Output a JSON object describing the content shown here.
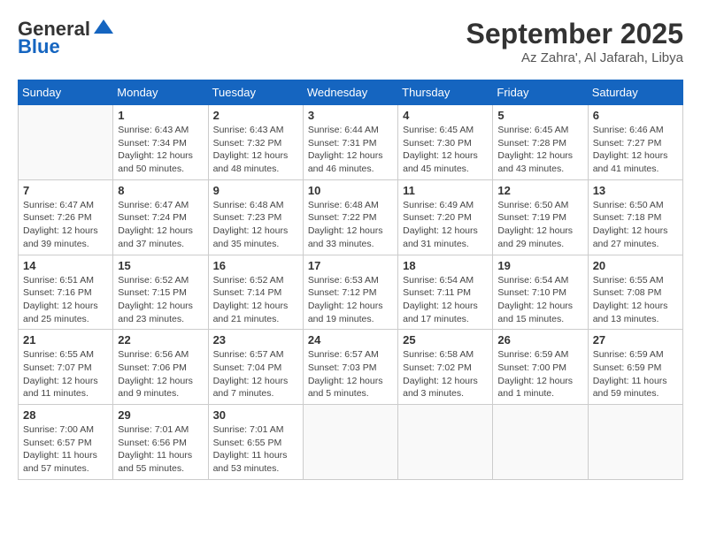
{
  "header": {
    "logo_line1": "General",
    "logo_line2": "Blue",
    "month": "September 2025",
    "location": "Az Zahra', Al Jafarah, Libya"
  },
  "weekdays": [
    "Sunday",
    "Monday",
    "Tuesday",
    "Wednesday",
    "Thursday",
    "Friday",
    "Saturday"
  ],
  "weeks": [
    [
      {
        "day": "",
        "info": ""
      },
      {
        "day": "1",
        "info": "Sunrise: 6:43 AM\nSunset: 7:34 PM\nDaylight: 12 hours\nand 50 minutes."
      },
      {
        "day": "2",
        "info": "Sunrise: 6:43 AM\nSunset: 7:32 PM\nDaylight: 12 hours\nand 48 minutes."
      },
      {
        "day": "3",
        "info": "Sunrise: 6:44 AM\nSunset: 7:31 PM\nDaylight: 12 hours\nand 46 minutes."
      },
      {
        "day": "4",
        "info": "Sunrise: 6:45 AM\nSunset: 7:30 PM\nDaylight: 12 hours\nand 45 minutes."
      },
      {
        "day": "5",
        "info": "Sunrise: 6:45 AM\nSunset: 7:28 PM\nDaylight: 12 hours\nand 43 minutes."
      },
      {
        "day": "6",
        "info": "Sunrise: 6:46 AM\nSunset: 7:27 PM\nDaylight: 12 hours\nand 41 minutes."
      }
    ],
    [
      {
        "day": "7",
        "info": "Sunrise: 6:47 AM\nSunset: 7:26 PM\nDaylight: 12 hours\nand 39 minutes."
      },
      {
        "day": "8",
        "info": "Sunrise: 6:47 AM\nSunset: 7:24 PM\nDaylight: 12 hours\nand 37 minutes."
      },
      {
        "day": "9",
        "info": "Sunrise: 6:48 AM\nSunset: 7:23 PM\nDaylight: 12 hours\nand 35 minutes."
      },
      {
        "day": "10",
        "info": "Sunrise: 6:48 AM\nSunset: 7:22 PM\nDaylight: 12 hours\nand 33 minutes."
      },
      {
        "day": "11",
        "info": "Sunrise: 6:49 AM\nSunset: 7:20 PM\nDaylight: 12 hours\nand 31 minutes."
      },
      {
        "day": "12",
        "info": "Sunrise: 6:50 AM\nSunset: 7:19 PM\nDaylight: 12 hours\nand 29 minutes."
      },
      {
        "day": "13",
        "info": "Sunrise: 6:50 AM\nSunset: 7:18 PM\nDaylight: 12 hours\nand 27 minutes."
      }
    ],
    [
      {
        "day": "14",
        "info": "Sunrise: 6:51 AM\nSunset: 7:16 PM\nDaylight: 12 hours\nand 25 minutes."
      },
      {
        "day": "15",
        "info": "Sunrise: 6:52 AM\nSunset: 7:15 PM\nDaylight: 12 hours\nand 23 minutes."
      },
      {
        "day": "16",
        "info": "Sunrise: 6:52 AM\nSunset: 7:14 PM\nDaylight: 12 hours\nand 21 minutes."
      },
      {
        "day": "17",
        "info": "Sunrise: 6:53 AM\nSunset: 7:12 PM\nDaylight: 12 hours\nand 19 minutes."
      },
      {
        "day": "18",
        "info": "Sunrise: 6:54 AM\nSunset: 7:11 PM\nDaylight: 12 hours\nand 17 minutes."
      },
      {
        "day": "19",
        "info": "Sunrise: 6:54 AM\nSunset: 7:10 PM\nDaylight: 12 hours\nand 15 minutes."
      },
      {
        "day": "20",
        "info": "Sunrise: 6:55 AM\nSunset: 7:08 PM\nDaylight: 12 hours\nand 13 minutes."
      }
    ],
    [
      {
        "day": "21",
        "info": "Sunrise: 6:55 AM\nSunset: 7:07 PM\nDaylight: 12 hours\nand 11 minutes."
      },
      {
        "day": "22",
        "info": "Sunrise: 6:56 AM\nSunset: 7:06 PM\nDaylight: 12 hours\nand 9 minutes."
      },
      {
        "day": "23",
        "info": "Sunrise: 6:57 AM\nSunset: 7:04 PM\nDaylight: 12 hours\nand 7 minutes."
      },
      {
        "day": "24",
        "info": "Sunrise: 6:57 AM\nSunset: 7:03 PM\nDaylight: 12 hours\nand 5 minutes."
      },
      {
        "day": "25",
        "info": "Sunrise: 6:58 AM\nSunset: 7:02 PM\nDaylight: 12 hours\nand 3 minutes."
      },
      {
        "day": "26",
        "info": "Sunrise: 6:59 AM\nSunset: 7:00 PM\nDaylight: 12 hours\nand 1 minute."
      },
      {
        "day": "27",
        "info": "Sunrise: 6:59 AM\nSunset: 6:59 PM\nDaylight: 11 hours\nand 59 minutes."
      }
    ],
    [
      {
        "day": "28",
        "info": "Sunrise: 7:00 AM\nSunset: 6:57 PM\nDaylight: 11 hours\nand 57 minutes."
      },
      {
        "day": "29",
        "info": "Sunrise: 7:01 AM\nSunset: 6:56 PM\nDaylight: 11 hours\nand 55 minutes."
      },
      {
        "day": "30",
        "info": "Sunrise: 7:01 AM\nSunset: 6:55 PM\nDaylight: 11 hours\nand 53 minutes."
      },
      {
        "day": "",
        "info": ""
      },
      {
        "day": "",
        "info": ""
      },
      {
        "day": "",
        "info": ""
      },
      {
        "day": "",
        "info": ""
      }
    ]
  ]
}
